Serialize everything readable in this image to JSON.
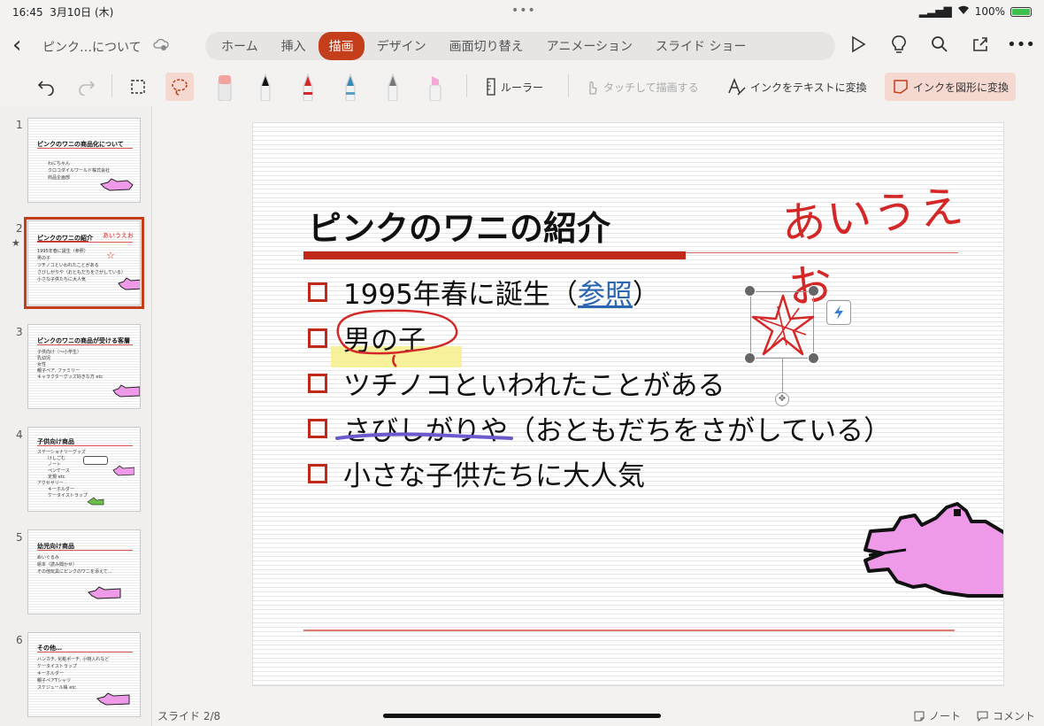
{
  "status": {
    "time": "16:45",
    "date": "3月10日 (木)",
    "battery": "100%"
  },
  "header": {
    "doc_title": "ピンク…について",
    "tabs": [
      {
        "label": "ホーム"
      },
      {
        "label": "挿入"
      },
      {
        "label": "描画",
        "active": true
      },
      {
        "label": "デザイン"
      },
      {
        "label": "画面切り替え"
      },
      {
        "label": "アニメーション"
      },
      {
        "label": "スライド ショー"
      }
    ]
  },
  "ribbon": {
    "ruler": "ルーラー",
    "touch_draw": "タッチして描画する",
    "ink_to_text": "インクをテキストに変換",
    "ink_to_shape": "インクを図形に変換"
  },
  "thumbnails": [
    {
      "num": "1",
      "title": "ピンクのワニの商品化について",
      "lines": [
        "わにちゃん",
        "クロコダイルワールド株式会社",
        "商品企画部"
      ]
    },
    {
      "num": "2",
      "title": "ピンクのワニの紹介",
      "ink": "あいうえお",
      "lines": [
        "1995年春に誕生（参照）",
        "男の子",
        "ツチノコといわれたことがある",
        "さびしがりや（おともだちをさがしている）",
        "小さな子供たちに大人気"
      ]
    },
    {
      "num": "3",
      "title": "ピンクのワニの商品が受ける客層",
      "lines": [
        "子供向け（～小学生）",
        "乳幼児",
        "女性",
        "親子ペア, ファミリー",
        "キャラクターグッズ好きな方 etc"
      ]
    },
    {
      "num": "4",
      "title": "子供向け商品",
      "lines": [
        "ステーショナリーグッズ",
        "けしごむ",
        "ノート",
        "ペンケース",
        "定規 etc",
        "アクセサリー",
        "キーホルダー",
        "ケータイストラップ"
      ]
    },
    {
      "num": "5",
      "title": "幼児向け商品",
      "lines": [
        "ぬいぐるみ",
        "絵本（読み聞かせ）",
        "その他玩具にピンクのワニを添えて..."
      ]
    },
    {
      "num": "6",
      "title": "その他…",
      "lines": [
        "ハンカチ, 化粧ポーチ, 小物入れなど",
        "ケータイストラップ",
        "キーホルダー",
        "親子ペアTシャツ",
        "スケジュール帳 etc"
      ]
    }
  ],
  "slide": {
    "title": "ピンクのワニの紹介",
    "handwriting": "あいうえお",
    "bullets": [
      {
        "pre": "1995年春に誕生（",
        "link": "参照",
        "post": "）"
      },
      {
        "text": "男の子"
      },
      {
        "text": "ツチノコといわれたことがある"
      },
      {
        "text": "さびしがりや（おともだちをさがしている）"
      },
      {
        "text": "小さな子供たちに大人気"
      }
    ]
  },
  "footer": {
    "slide_count": "スライド 2/8",
    "notes": "ノート",
    "comments": "コメント"
  },
  "colors": {
    "accent": "#c43e1c",
    "pink": "#ef9ae8",
    "ink_red": "#d42828"
  }
}
